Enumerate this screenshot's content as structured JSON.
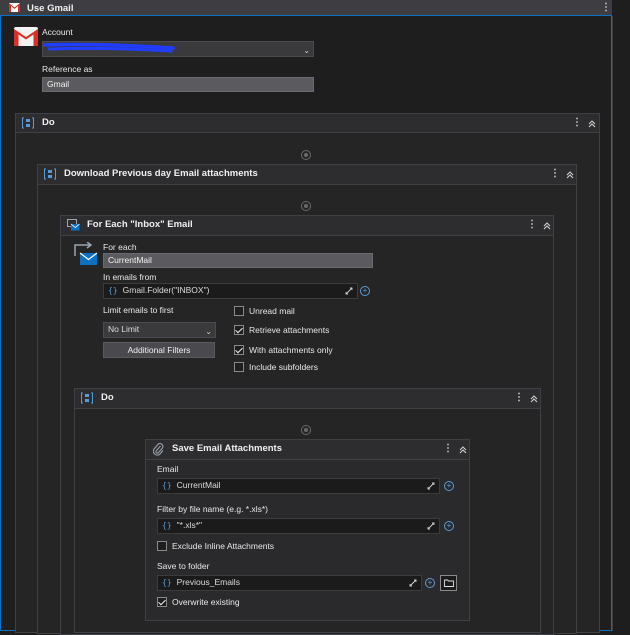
{
  "gmail": {
    "title": "Use Gmail",
    "account_label": "Account",
    "account_value": "",
    "reference_label": "Reference as",
    "reference_value": "Gmail"
  },
  "do_outer": {
    "title": "Do"
  },
  "download": {
    "title": "Download Previous day Email attachments"
  },
  "foreach": {
    "title": "For Each \"Inbox\" Email",
    "for_each_label": "For each",
    "for_each_value": "CurrentMail",
    "in_emails_label": "In emails from",
    "in_emails_value": "Gmail.Folder(\"INBOX\")",
    "limit_label": "Limit emails to first",
    "limit_value": "No Limit",
    "filters_button": "Additional Filters",
    "options": [
      {
        "label": "Unread mail",
        "checked": false
      },
      {
        "label": "Retrieve attachments",
        "checked": true
      },
      {
        "label": "With attachments only",
        "checked": true
      },
      {
        "label": "Include subfolders",
        "checked": false
      }
    ]
  },
  "do_inner": {
    "title": "Do"
  },
  "save": {
    "title": "Save Email Attachments",
    "email_label": "Email",
    "email_value": "CurrentMail",
    "filter_label": "Filter by file name (e.g. *.xls*)",
    "filter_value": "\"*.xls*\"",
    "exclude_label": "Exclude Inline Attachments",
    "exclude_checked": false,
    "folder_label": "Save to folder",
    "folder_value": "Previous_Emails",
    "overwrite_label": "Overwrite existing",
    "overwrite_checked": true
  },
  "colors": {
    "accent": "#0e70c0",
    "gmail_red": "#d93025",
    "redaction": "#1f3cff",
    "panel": "#252526",
    "background": "#1e1e1e"
  }
}
